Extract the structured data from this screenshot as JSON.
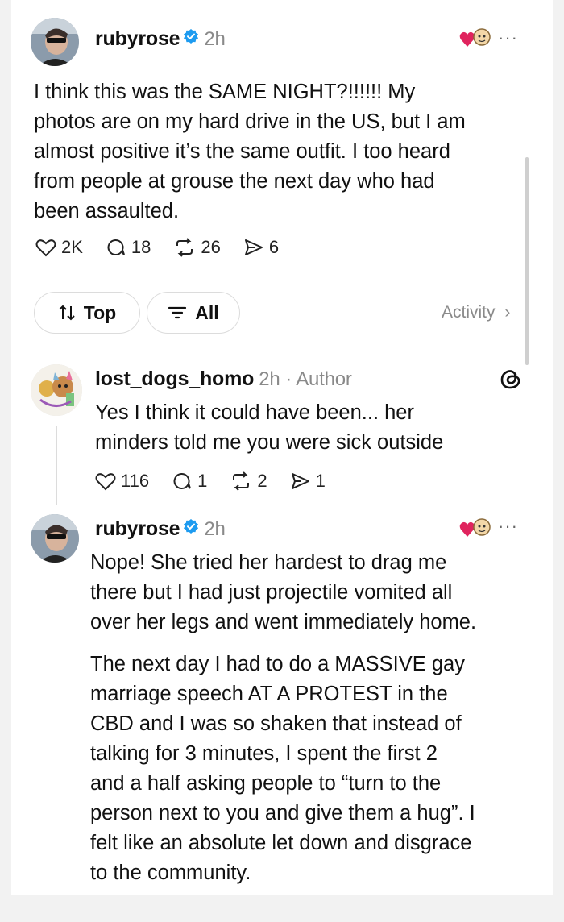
{
  "post": {
    "username": "rubyrose",
    "time": "2h",
    "text_lines": [
      "I think this was the SAME NIGHT?!!!!!! My",
      "photos are on my hard drive in the US, but I am",
      "almost positive it’s the same outfit. I too heard",
      "from people at grouse the next day who had",
      "been assaulted."
    ],
    "stats": {
      "likes": "2K",
      "comments": "18",
      "reposts": "26",
      "shares": "6"
    },
    "more_label": "···"
  },
  "filters": {
    "top_label": "Top",
    "all_label": "All",
    "activity_label": "Activity"
  },
  "reply1": {
    "username": "lost_dogs_homo",
    "time": "2h",
    "author_label": "· Author",
    "text_lines": [
      "Yes I think it could have been... her",
      "minders told me you were sick outside"
    ],
    "stats": {
      "likes": "116",
      "comments": "1",
      "reposts": "2",
      "shares": "1"
    }
  },
  "reply2": {
    "username": "rubyrose",
    "time": "2h",
    "more_label": "···",
    "para1_lines": [
      "Nope! She tried her hardest to drag me",
      "there but I had just projectile vomited all",
      "over her legs and went immediately home."
    ],
    "para2_lines": [
      "The next day I had to do a MASSIVE gay",
      "marriage speech AT A PROTEST in the",
      "CBD and I was so shaken that instead of",
      "talking for 3 minutes, I spent the first 2",
      "and a half asking people to “turn to the",
      "person next to you and give them a hug”. I",
      "felt like an absolute let down and disgrace",
      "to the community."
    ]
  },
  "colors": {
    "verified": "#1d9bf0",
    "heart": "#e0245e",
    "muted": "#8a8a8a"
  }
}
